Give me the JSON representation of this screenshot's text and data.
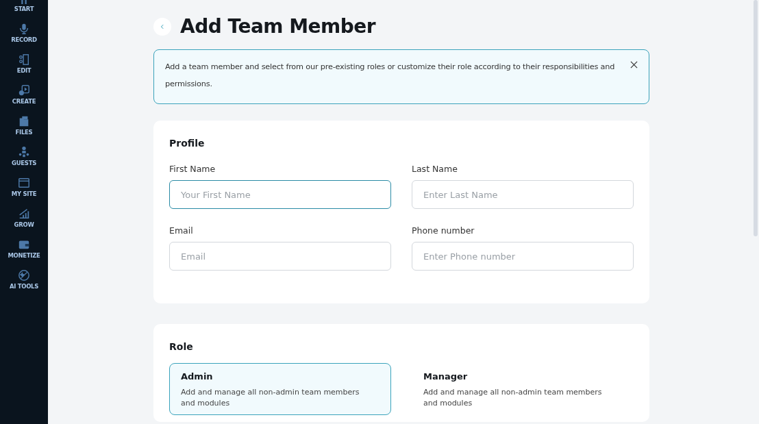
{
  "sidebar": {
    "items": [
      {
        "label": "START",
        "kind": "start"
      },
      {
        "label": "RECORD",
        "kind": "mic"
      },
      {
        "label": "EDIT",
        "kind": "edit"
      },
      {
        "label": "CREATE",
        "kind": "create"
      },
      {
        "label": "FILES",
        "kind": "files"
      },
      {
        "label": "GUESTS",
        "kind": "guests"
      },
      {
        "label": "MY SITE",
        "kind": "site"
      },
      {
        "label": "GROW",
        "kind": "grow"
      },
      {
        "label": "MONETIZE",
        "kind": "wallet"
      },
      {
        "label": "AI TOOLS",
        "kind": "ai"
      }
    ]
  },
  "page": {
    "title": "Add Team Member"
  },
  "notice": {
    "text": "Add a team member and select from our pre-existing roles or customize their role according to their responsibilities and permissions."
  },
  "profile": {
    "heading": "Profile",
    "fields": [
      {
        "label": "First Name",
        "placeholder": "Your First Name",
        "focused": true
      },
      {
        "label": "Last Name",
        "placeholder": "Enter Last Name",
        "focused": false
      },
      {
        "label": "Email",
        "placeholder": "Email",
        "focused": false
      },
      {
        "label": "Phone number",
        "placeholder": "Enter Phone number",
        "focused": false
      }
    ]
  },
  "role": {
    "heading": "Role",
    "options": [
      {
        "name": "Admin",
        "description": "Add and manage all non-admin team members and modules",
        "selected": true
      },
      {
        "name": "Manager",
        "description": "Add and manage all non-admin team members and modules",
        "selected": false
      }
    ]
  }
}
